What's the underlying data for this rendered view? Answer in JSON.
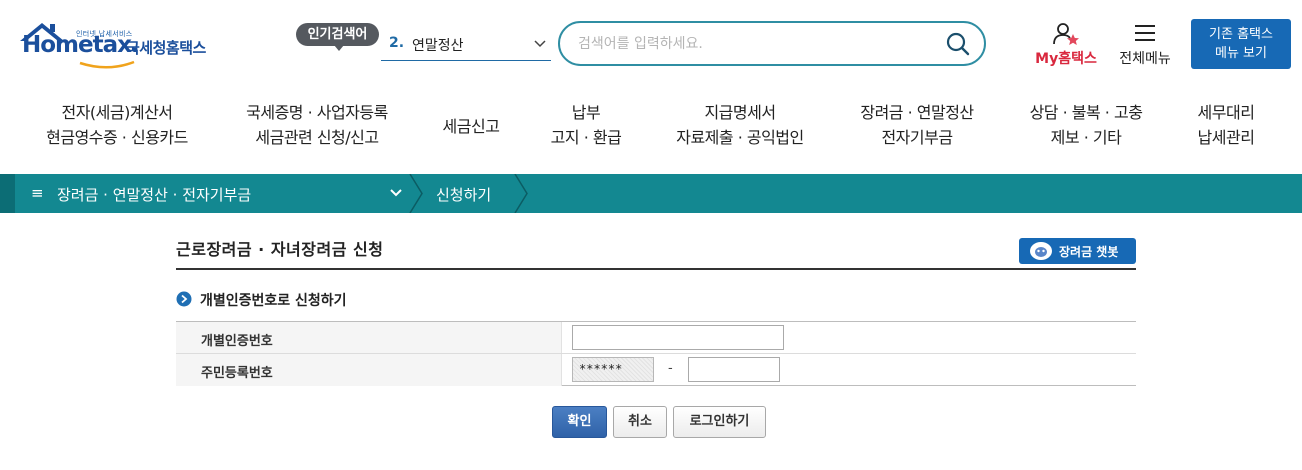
{
  "header": {
    "logo": {
      "small_text": "인터넷 납세서비스",
      "brand_en": "Hometax.",
      "brand_ko": "국세청홈택스"
    },
    "popular_search": {
      "tag": "인기검색어",
      "rank": "2.",
      "keyword": "연말정산"
    },
    "search": {
      "placeholder": "검색어를 입력하세요."
    },
    "my_hometax": "My홈택스",
    "full_menu": "전체메뉴",
    "legacy_button": {
      "line1": "기존 홈택스",
      "line2": "메뉴 보기"
    }
  },
  "gnb": [
    {
      "line1": "전자(세금)계산서",
      "line2": "현금영수증 · 신용카드"
    },
    {
      "line1": "국세증명 · 사업자등록",
      "line2": "세금관련 신청/신고"
    },
    {
      "line1": "세금신고",
      "line2": ""
    },
    {
      "line1": "납부",
      "line2": "고지 · 환급"
    },
    {
      "line1": "지급명세서",
      "line2": "자료제출 · 공익법인"
    },
    {
      "line1": "장려금 · 연말정산",
      "line2": "전자기부금"
    },
    {
      "line1": "상담 · 불복 · 고충",
      "line2": "제보 · 기타"
    },
    {
      "line1": "세무대리",
      "line2": "납세관리"
    }
  ],
  "breadcrumb": {
    "menu": "장려금 · 연말정산 · 전자기부금",
    "current": "신청하기"
  },
  "page": {
    "title": "근로장려금 · 자녀장려금 신청",
    "chatbot_button": "장려금 챗봇",
    "section_title": "개별인증번호로 신청하기",
    "form": {
      "auth_label": "개별인증번호",
      "auth_value": "",
      "rrn_label": "주민등록번호",
      "rrn_front_masked": "******",
      "rrn_dash": "-",
      "rrn_back_value": ""
    },
    "buttons": {
      "confirm": "확인",
      "cancel": "취소",
      "login": "로그인하기"
    }
  },
  "colors": {
    "brand_blue": "#1769b5",
    "teal_bar": "#138891",
    "search_border": "#2f8ea3",
    "my_red": "#d9283e"
  }
}
